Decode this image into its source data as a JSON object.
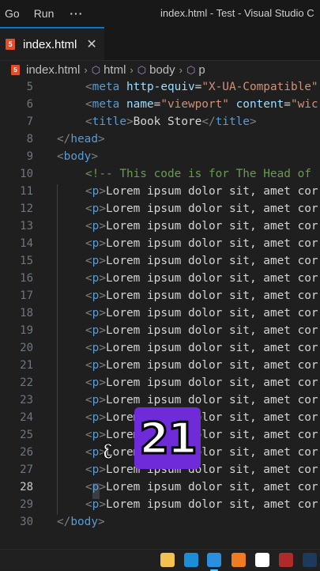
{
  "menubar": {
    "items": [
      "Go",
      "Run"
    ],
    "more": "···",
    "window_title": "index.html - Test - Visual Studio C"
  },
  "tab": {
    "label": "index.html",
    "close": "✕",
    "file_icon": "5"
  },
  "breadcrumb": {
    "file": "index.html",
    "items": [
      "html",
      "body",
      "p"
    ],
    "separator": "›"
  },
  "editor": {
    "lines": [
      {
        "n": "5",
        "code": "<meta http-equiv=\"X-UA-Compatible\""
      },
      {
        "n": "6",
        "code": "<meta name=\"viewport\" content=\"wic"
      },
      {
        "n": "7",
        "code": "<title>Book Store</title>"
      },
      {
        "n": "8",
        "code": "</head>"
      },
      {
        "n": "9",
        "code": "<body>"
      },
      {
        "n": "10",
        "code": "<!-- This code is for The Head of"
      },
      {
        "n": "11",
        "code": "<p>Lorem ipsum dolor sit, amet cor"
      },
      {
        "n": "12",
        "code": "<p>Lorem ipsum dolor sit, amet cor"
      },
      {
        "n": "13",
        "code": "<p>Lorem ipsum dolor sit, amet cor"
      },
      {
        "n": "14",
        "code": "<p>Lorem ipsum dolor sit, amet cor"
      },
      {
        "n": "15",
        "code": "<p>Lorem ipsum dolor sit, amet cor"
      },
      {
        "n": "16",
        "code": "<p>Lorem ipsum dolor sit, amet cor"
      },
      {
        "n": "17",
        "code": "<p>Lorem ipsum dolor sit, amet cor"
      },
      {
        "n": "18",
        "code": "<p>Lorem ipsum dolor sit, amet cor"
      },
      {
        "n": "19",
        "code": "<p>Lorem ipsum dolor sit, amet cor"
      },
      {
        "n": "20",
        "code": "<p>Lorem ipsum dolor sit, amet cor"
      },
      {
        "n": "21",
        "code": "<p>Lorem ipsum dolor sit, amet cor"
      },
      {
        "n": "22",
        "code": "<p>Lorem ipsum dolor sit, amet cor"
      },
      {
        "n": "23",
        "code": "<p>Lorem ipsum dolor sit, amet cor"
      },
      {
        "n": "24",
        "code": "<p>Lorem ipsum dolor sit, amet cor"
      },
      {
        "n": "25",
        "code": "<p>Lorem ipsum dolor sit, amet cor"
      },
      {
        "n": "26",
        "code": "<p>Lorem ipsum dolor sit, amet cor"
      },
      {
        "n": "27",
        "code": "<p>Lorem ipsum dolor sit, amet cor"
      },
      {
        "n": "28",
        "code": "<p>Lorem ipsum dolor sit, amet cor"
      },
      {
        "n": "29",
        "code": "<p>Lorem ipsum dolor sit, amet cor"
      },
      {
        "n": "30",
        "code": "</body>"
      }
    ],
    "active_line": "28"
  },
  "overlay": {
    "number": "21",
    "script_char": "ᦷ"
  },
  "taskbar": {
    "icons": [
      {
        "name": "file-explorer-icon",
        "color": "#f2c14e"
      },
      {
        "name": "edge-icon",
        "color": "#1a8fd8"
      },
      {
        "name": "vscode-icon",
        "color": "#2b8fe0",
        "active": true
      },
      {
        "name": "app-orange-icon",
        "color": "#f07c22"
      },
      {
        "name": "notion-icon",
        "color": "#ffffff"
      },
      {
        "name": "pinned-app-icon",
        "color": "#b02a2a"
      },
      {
        "name": "photoshop-icon",
        "color": "#1d3a5c"
      },
      {
        "name": "steam-icon",
        "color": "#2a475e"
      }
    ]
  },
  "colors": {
    "accent": "#0078d4",
    "badge": "#6f2bd8",
    "background": "#1f1f1f"
  }
}
